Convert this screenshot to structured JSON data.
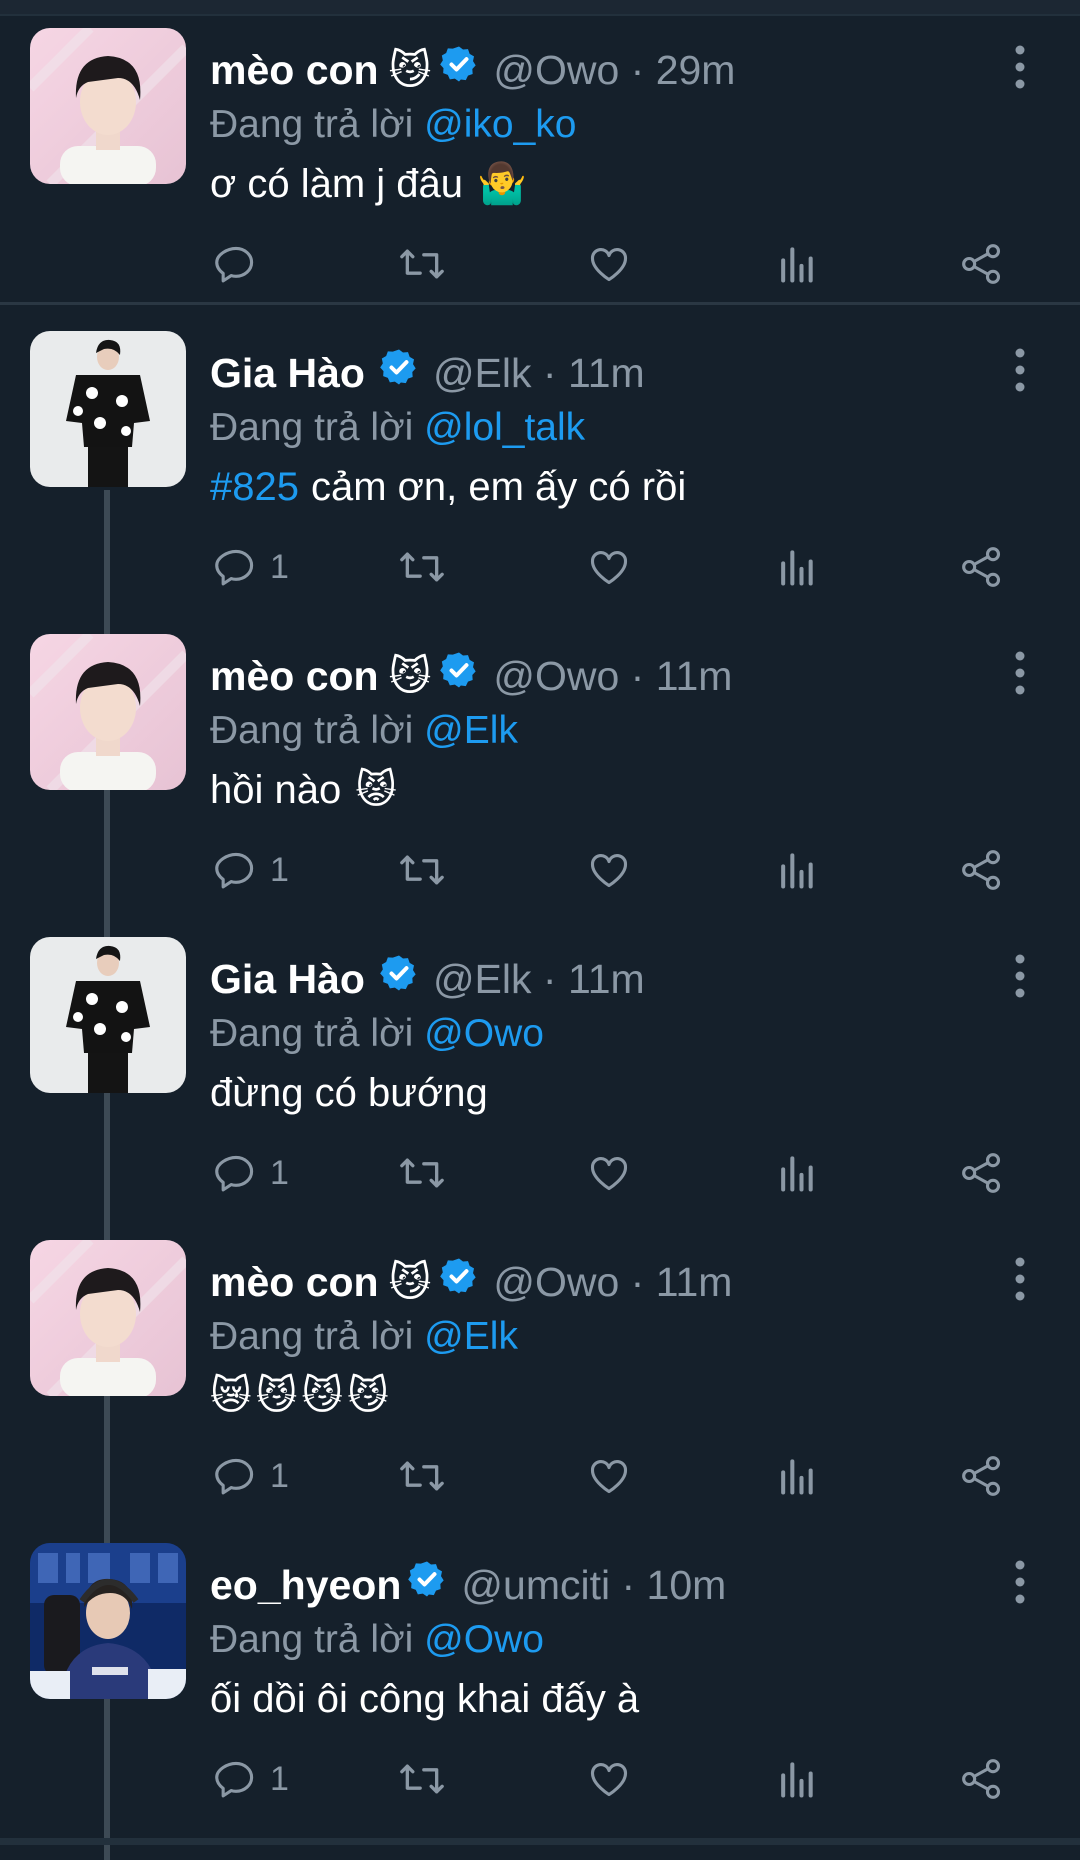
{
  "colors": {
    "background": "#15202b",
    "accent": "#1d9bf0",
    "muted": "#8b98a5",
    "thread": "#3d4a55"
  },
  "tweets": [
    {
      "name": "mèo con",
      "emoji": "😼",
      "verified": true,
      "handle": "@Owo",
      "time": "29m",
      "meta": "@Owo · 29m",
      "replying_label": "Đang trả lời",
      "replying_to": "@iko_ko",
      "hashtag": "",
      "text": "ơ có làm j đâu",
      "text_emoji": "🤷‍♂️",
      "reply_count": ""
    },
    {
      "name": "Gia Hào",
      "emoji": "",
      "verified": true,
      "handle": "@Elk",
      "time": "11m",
      "meta": "@Elk · 11m",
      "replying_label": "Đang trả lời",
      "replying_to": "@lol_talk",
      "hashtag": "#825",
      "text": "cảm ơn, em ấy có rồi",
      "text_emoji": "",
      "reply_count": "1"
    },
    {
      "name": "mèo con",
      "emoji": "😼",
      "verified": true,
      "handle": "@Owo",
      "time": "11m",
      "meta": "@Owo · 11m",
      "replying_label": "Đang trả lời",
      "replying_to": "@Elk",
      "hashtag": "",
      "text": "hồi nào",
      "text_emoji": "😾",
      "reply_count": "1"
    },
    {
      "name": "Gia Hào",
      "emoji": "",
      "verified": true,
      "handle": "@Elk",
      "time": "11m",
      "meta": "@Elk · 11m",
      "replying_label": "Đang trả lời",
      "replying_to": "@Owo",
      "hashtag": "",
      "text": "đừng có bướng",
      "text_emoji": "",
      "reply_count": "1"
    },
    {
      "name": "mèo con",
      "emoji": "😼",
      "verified": true,
      "handle": "@Owo",
      "time": "11m",
      "meta": "@Owo · 11m",
      "replying_label": "Đang trả lời",
      "replying_to": "@Elk",
      "hashtag": "",
      "text": "",
      "text_emoji": "😿😼😼😼",
      "reply_count": "1"
    },
    {
      "name": "eo_hyeon",
      "emoji": "",
      "verified": true,
      "handle": "@umciti",
      "time": "10m",
      "meta": "@umciti · 10m",
      "replying_label": "Đang trả lời",
      "replying_to": "@Owo",
      "hashtag": "",
      "text": "ối dồi ôi công khai đấy à",
      "text_emoji": "",
      "reply_count": "1"
    }
  ],
  "icons": {
    "reply": "reply-icon",
    "retweet": "retweet-icon",
    "like": "heart-icon",
    "views": "views-icon",
    "share": "share-icon",
    "more": "more-vertical-icon",
    "verified": "verified-badge-icon"
  }
}
